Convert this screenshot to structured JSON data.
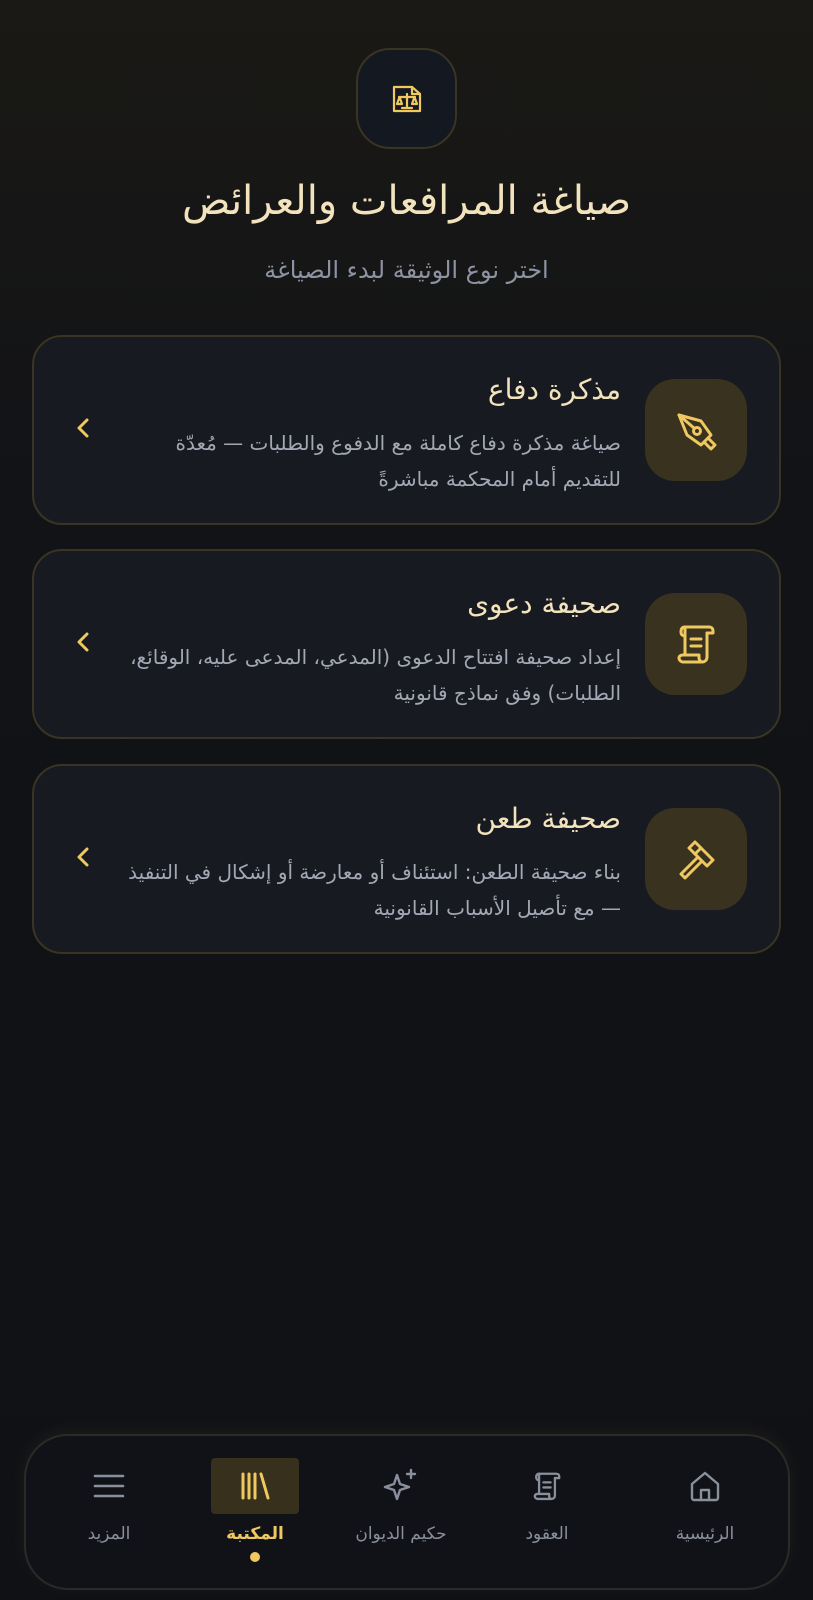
{
  "header": {
    "icon": "scales-document-icon",
    "title": "صياغة المرافعات والعرائض",
    "subtitle": "اختر نوع الوثيقة لبدء الصياغة"
  },
  "cards": [
    {
      "icon": "pen-nib-icon",
      "title": "مذكرة دفاع",
      "description": "صياغة مذكرة دفاع كاملة مع الدفوع والطلبات — مُعدّة للتقديم أمام المحكمة مباشرةً"
    },
    {
      "icon": "scroll-icon",
      "title": "صحيفة دعوى",
      "description": "إعداد صحيفة افتتاح الدعوى (المدعي، المدعى عليه، الوقائع، الطلبات) وفق نماذج قانونية"
    },
    {
      "icon": "gavel-icon",
      "title": "صحيفة طعن",
      "description": "بناء صحيفة الطعن: استئناف أو معارضة أو إشكال في التنفيذ — مع تأصيل الأسباب القانونية"
    }
  ],
  "bottom_nav": {
    "items": [
      {
        "label": "الرئيسية",
        "icon": "home-icon",
        "active": false
      },
      {
        "label": "العقود",
        "icon": "scroll-icon",
        "active": false
      },
      {
        "label": "حكيم الديوان",
        "icon": "sparkles-icon",
        "active": false
      },
      {
        "label": "المكتبة",
        "icon": "library-icon",
        "active": true
      },
      {
        "label": "المزيد",
        "icon": "menu-icon",
        "active": false
      }
    ]
  },
  "colors": {
    "accent": "#f0c860",
    "card_bg": "#171a21",
    "icon_bg": "#38321f",
    "border": "#3a3422",
    "text_primary": "#f2e3bd",
    "text_secondary": "#a4a8b5"
  }
}
